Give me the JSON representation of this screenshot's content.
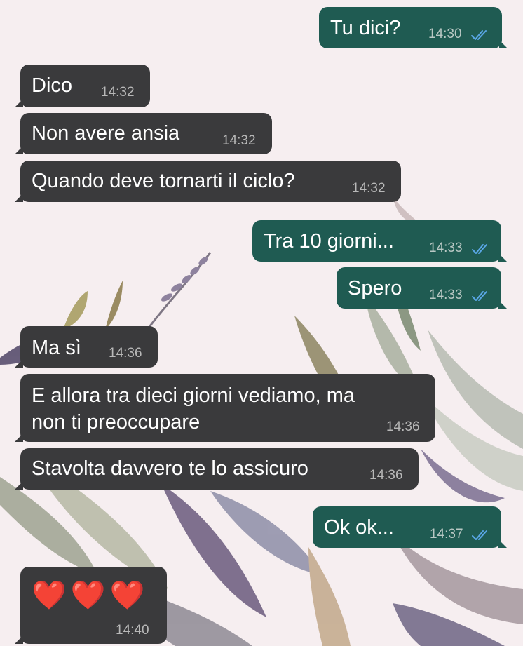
{
  "chat": {
    "colors": {
      "incoming_bubble": "#3a3a3c",
      "outgoing_bubble": "#1f5b52",
      "read_ticks": "#5aa7e6",
      "heart": "#e51d2a"
    },
    "messages": [
      {
        "text": "Tu dici?",
        "time": "14:30",
        "direction": "outgoing",
        "read": true
      },
      {
        "text": "Dico",
        "time": "14:32",
        "direction": "incoming"
      },
      {
        "text": "Non avere ansia",
        "time": "14:32",
        "direction": "incoming"
      },
      {
        "text": "Quando deve tornarti il ciclo?",
        "time": "14:32",
        "direction": "incoming"
      },
      {
        "text": "Tra 10 giorni...",
        "time": "14:33",
        "direction": "outgoing",
        "read": true
      },
      {
        "text": "Spero",
        "time": "14:33",
        "direction": "outgoing",
        "read": true
      },
      {
        "text": "Ma sì",
        "time": "14:36",
        "direction": "incoming"
      },
      {
        "text": "E allora tra dieci giorni vediamo, ma\nnon ti preoccupare",
        "time": "14:36",
        "direction": "incoming"
      },
      {
        "text": "Stavolta davvero te lo assicuro",
        "time": "14:36",
        "direction": "incoming"
      },
      {
        "text": "Ok ok...",
        "time": "14:37",
        "direction": "outgoing",
        "read": true
      },
      {
        "text": "❤️❤️❤️",
        "time": "14:40",
        "direction": "incoming",
        "emoji": [
          "heart-icon",
          "heart-icon",
          "heart-icon"
        ]
      }
    ]
  }
}
